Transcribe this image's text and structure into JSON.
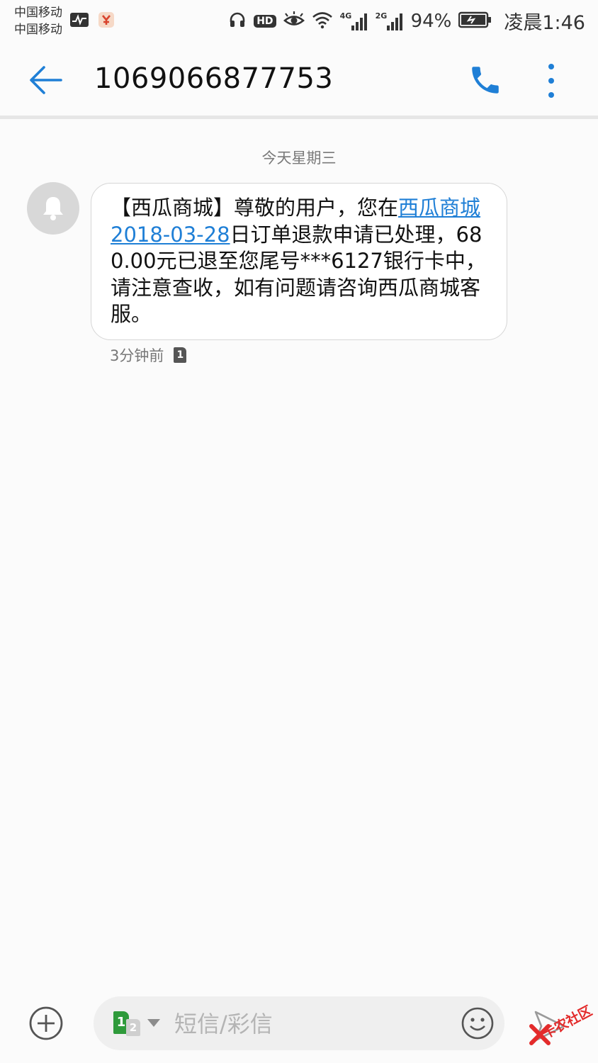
{
  "status_bar": {
    "carrier_1": "中国移动",
    "carrier_2": "中国移动",
    "network_1": "4G",
    "network_2": "2G",
    "battery": "94%",
    "time": "凌晨1:46",
    "hd_label": "HD",
    "icons": [
      "activity-monitor-icon",
      "app-notification-icon",
      "headset-icon",
      "hd-icon",
      "eye-comfort-icon",
      "wifi-icon",
      "signal-icon",
      "battery-icon"
    ]
  },
  "header": {
    "title": "1069066877753",
    "icons": [
      "back-arrow-icon",
      "phone-call-icon",
      "more-vertical-icon"
    ]
  },
  "conversation": {
    "date_separator": "今天星期三",
    "message": {
      "text_before": "【西瓜商城】尊敬的用户，您在",
      "link_text": "西瓜商城2018-03-28",
      "text_after": "日订单退款申请已处理，680.00元已退至您尾号***6127银行卡中，请注意查收，如有问题请咨询西瓜商城客服。",
      "time": "3分钟前",
      "sim": "1"
    }
  },
  "compose": {
    "placeholder": "短信/彩信",
    "sim_active": "1",
    "sim_inactive": "2"
  },
  "watermark": {
    "text": "卡农社区"
  },
  "colors": {
    "accent": "#1f7fd6",
    "background": "#fbfbfb",
    "sim_green": "#2e9a3a",
    "watermark_red": "#e32b2b"
  }
}
